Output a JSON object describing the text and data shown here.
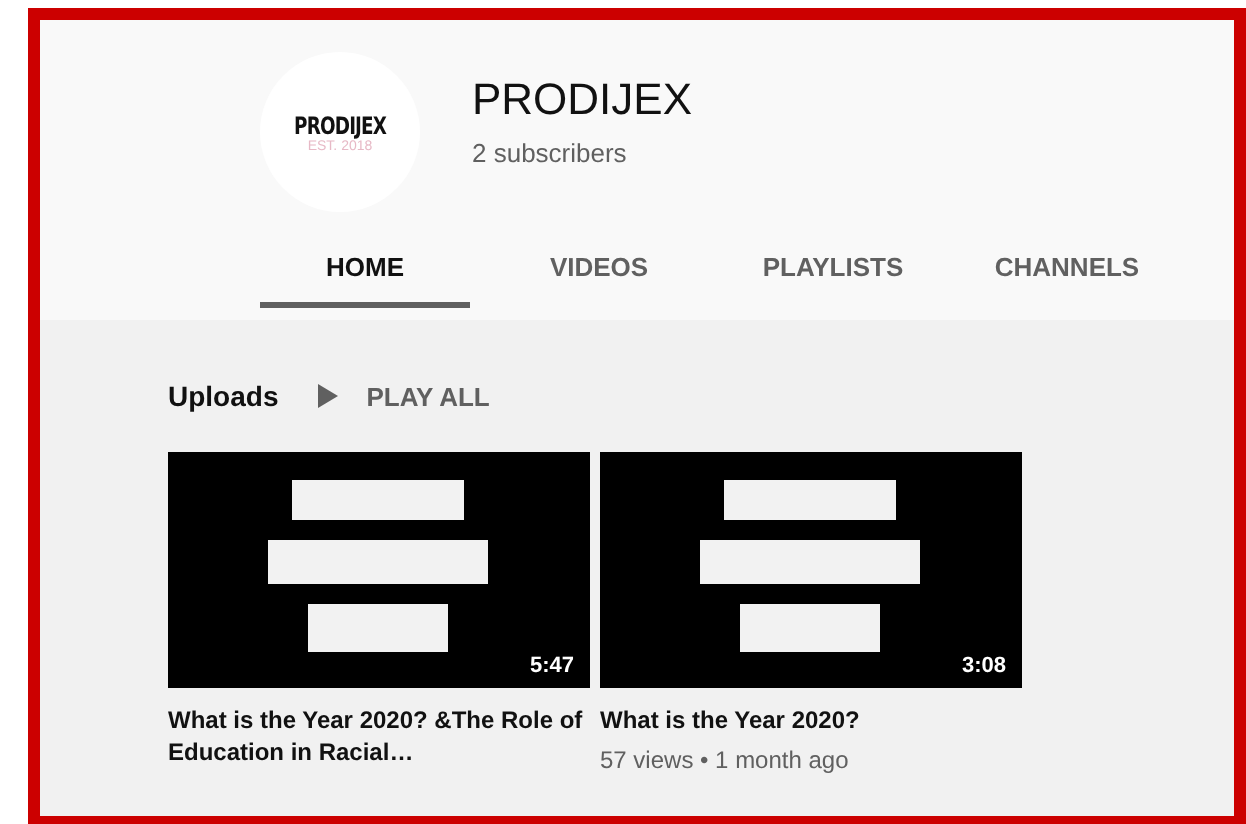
{
  "channel": {
    "logo_name": "PRODIJEX",
    "logo_tagline": "EST. 2018",
    "name": "PRODIJEX",
    "subscribers": "2 subscribers"
  },
  "tabs": [
    {
      "label": "HOME",
      "selected": true
    },
    {
      "label": "VIDEOS",
      "selected": false
    },
    {
      "label": "PLAYLISTS",
      "selected": false
    },
    {
      "label": "CHANNELS",
      "selected": false
    }
  ],
  "section": {
    "title": "Uploads",
    "play_all": "PLAY ALL"
  },
  "videos": [
    {
      "duration": "5:47",
      "title": "What is the Year 2020? &The Role of Education in Racial…"
    },
    {
      "duration": "3:08",
      "title": "What is the Year 2020?",
      "meta": "57 views • 1 month ago"
    }
  ]
}
